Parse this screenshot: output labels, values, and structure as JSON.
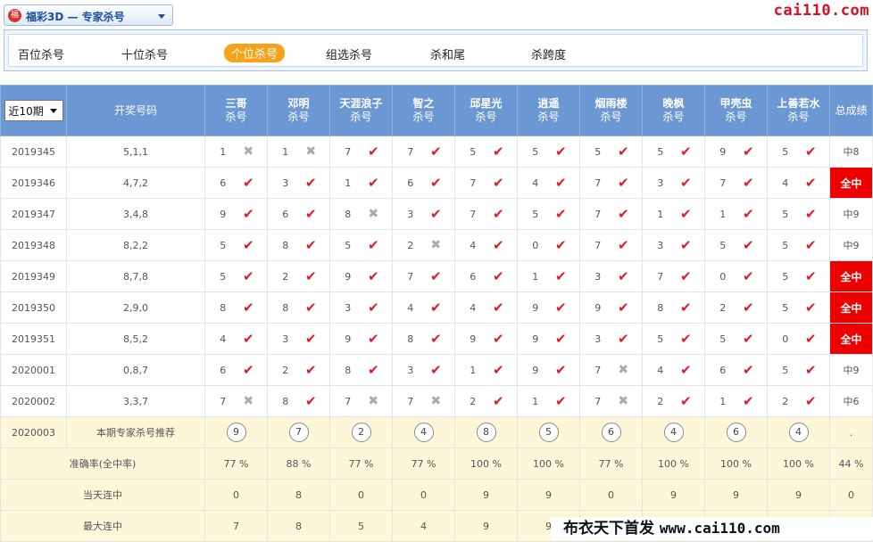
{
  "header": {
    "logo_text": "福",
    "game_title": "福彩3D — 专家杀号",
    "brand": "cai110.com"
  },
  "tabs": [
    "百位杀号",
    "十位杀号",
    "个位杀号",
    "组选杀号",
    "杀和尾",
    "杀跨度"
  ],
  "active_tab": 2,
  "table": {
    "period_select": "近10期",
    "draw_header": "开奖号码",
    "experts": [
      {
        "name": "三哥",
        "sub": "杀号"
      },
      {
        "name": "邓明",
        "sub": "杀号"
      },
      {
        "name": "天涯浪子",
        "sub": "杀号"
      },
      {
        "name": "智之",
        "sub": "杀号"
      },
      {
        "name": "邱星光",
        "sub": "杀号"
      },
      {
        "name": "逍遥",
        "sub": "杀号"
      },
      {
        "name": "烟雨楼",
        "sub": "杀号"
      },
      {
        "name": "晚枫",
        "sub": "杀号"
      },
      {
        "name": "甲壳虫",
        "sub": "杀号"
      },
      {
        "name": "上善若水",
        "sub": "杀号"
      }
    ],
    "total_header": "总成绩",
    "rows": [
      {
        "issue": "2019345",
        "draw": "5,1,1",
        "kills": [
          [
            1,
            false
          ],
          [
            1,
            false
          ],
          [
            7,
            true
          ],
          [
            7,
            true
          ],
          [
            5,
            true
          ],
          [
            5,
            true
          ],
          [
            5,
            true
          ],
          [
            5,
            true
          ],
          [
            9,
            true
          ],
          [
            5,
            true
          ]
        ],
        "total": "中8",
        "full": false
      },
      {
        "issue": "2019346",
        "draw": "4,7,2",
        "kills": [
          [
            6,
            true
          ],
          [
            3,
            true
          ],
          [
            1,
            true
          ],
          [
            6,
            true
          ],
          [
            7,
            true
          ],
          [
            4,
            true
          ],
          [
            7,
            true
          ],
          [
            3,
            true
          ],
          [
            7,
            true
          ],
          [
            4,
            true
          ]
        ],
        "total": "全中",
        "full": true
      },
      {
        "issue": "2019347",
        "draw": "3,4,8",
        "kills": [
          [
            9,
            true
          ],
          [
            6,
            true
          ],
          [
            8,
            false
          ],
          [
            3,
            true
          ],
          [
            7,
            true
          ],
          [
            5,
            true
          ],
          [
            7,
            true
          ],
          [
            1,
            true
          ],
          [
            1,
            true
          ],
          [
            5,
            true
          ]
        ],
        "total": "中9",
        "full": false
      },
      {
        "issue": "2019348",
        "draw": "8,2,2",
        "kills": [
          [
            5,
            true
          ],
          [
            8,
            true
          ],
          [
            5,
            true
          ],
          [
            2,
            false
          ],
          [
            4,
            true
          ],
          [
            0,
            true
          ],
          [
            7,
            true
          ],
          [
            3,
            true
          ],
          [
            5,
            true
          ],
          [
            5,
            true
          ]
        ],
        "total": "中9",
        "full": false
      },
      {
        "issue": "2019349",
        "draw": "8,7,8",
        "kills": [
          [
            5,
            true
          ],
          [
            2,
            true
          ],
          [
            9,
            true
          ],
          [
            7,
            true
          ],
          [
            6,
            true
          ],
          [
            1,
            true
          ],
          [
            3,
            true
          ],
          [
            7,
            true
          ],
          [
            0,
            true
          ],
          [
            5,
            true
          ]
        ],
        "total": "全中",
        "full": true
      },
      {
        "issue": "2019350",
        "draw": "2,9,0",
        "kills": [
          [
            8,
            true
          ],
          [
            8,
            true
          ],
          [
            3,
            true
          ],
          [
            4,
            true
          ],
          [
            4,
            true
          ],
          [
            9,
            true
          ],
          [
            9,
            true
          ],
          [
            8,
            true
          ],
          [
            2,
            true
          ],
          [
            5,
            true
          ]
        ],
        "total": "全中",
        "full": true
      },
      {
        "issue": "2019351",
        "draw": "8,5,2",
        "kills": [
          [
            4,
            true
          ],
          [
            3,
            true
          ],
          [
            9,
            true
          ],
          [
            8,
            true
          ],
          [
            9,
            true
          ],
          [
            9,
            true
          ],
          [
            3,
            true
          ],
          [
            5,
            true
          ],
          [
            5,
            true
          ],
          [
            0,
            true
          ]
        ],
        "total": "全中",
        "full": true
      },
      {
        "issue": "2020001",
        "draw": "0,8,7",
        "kills": [
          [
            6,
            true
          ],
          [
            2,
            true
          ],
          [
            8,
            true
          ],
          [
            3,
            true
          ],
          [
            1,
            true
          ],
          [
            9,
            true
          ],
          [
            7,
            false
          ],
          [
            4,
            true
          ],
          [
            6,
            true
          ],
          [
            5,
            true
          ]
        ],
        "total": "中9",
        "full": false
      },
      {
        "issue": "2020002",
        "draw": "3,3,7",
        "kills": [
          [
            7,
            false
          ],
          [
            8,
            true
          ],
          [
            7,
            false
          ],
          [
            7,
            false
          ],
          [
            2,
            true
          ],
          [
            1,
            true
          ],
          [
            7,
            false
          ],
          [
            2,
            true
          ],
          [
            1,
            true
          ],
          [
            2,
            true
          ]
        ],
        "total": "中6",
        "full": false
      }
    ],
    "recommend": {
      "issue": "2020003",
      "label": "本期专家杀号推荐",
      "picks": [
        9,
        7,
        2,
        4,
        8,
        5,
        6,
        4,
        6,
        4
      ],
      "total": "."
    },
    "accuracy": {
      "label": "准确率(全中率)",
      "values": [
        "77 %",
        "88 %",
        "77 %",
        "77 %",
        "100 %",
        "100 %",
        "77 %",
        "100 %",
        "100 %",
        "100 %"
      ],
      "total": "44 %"
    },
    "today_streak": {
      "label": "当天连中",
      "values": [
        "0",
        "8",
        "0",
        "0",
        "9",
        "9",
        "0",
        "9",
        "9",
        "9"
      ],
      "total": "0"
    },
    "max_streak": {
      "label": "最大连中",
      "values": [
        "7",
        "8",
        "5",
        "4",
        "9",
        "9",
        "",
        "",
        "",
        ""
      ],
      "total": ""
    }
  },
  "footer": {
    "text": "布衣天下首发",
    "url": "www.cai110.com"
  },
  "colors": {
    "header_blue": "#6b98d2",
    "full_red": "#ee0000",
    "check_red": "#e01b2a",
    "tab_orange": "#f6a21b"
  }
}
